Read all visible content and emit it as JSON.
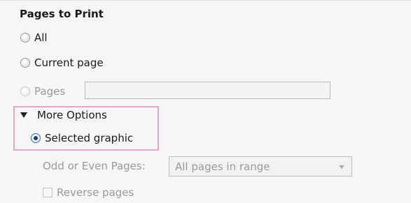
{
  "pages_to_print": {
    "title": "Pages to Print",
    "options": {
      "all": "All",
      "current_page": "Current page",
      "pages": "Pages"
    },
    "pages_input_value": ""
  },
  "more_options": {
    "label": "More Options",
    "selected_graphic": "Selected graphic",
    "odd_even_label": "Odd or Even Pages:",
    "odd_even_value": "All pages in range",
    "reverse_pages": "Reverse pages"
  }
}
